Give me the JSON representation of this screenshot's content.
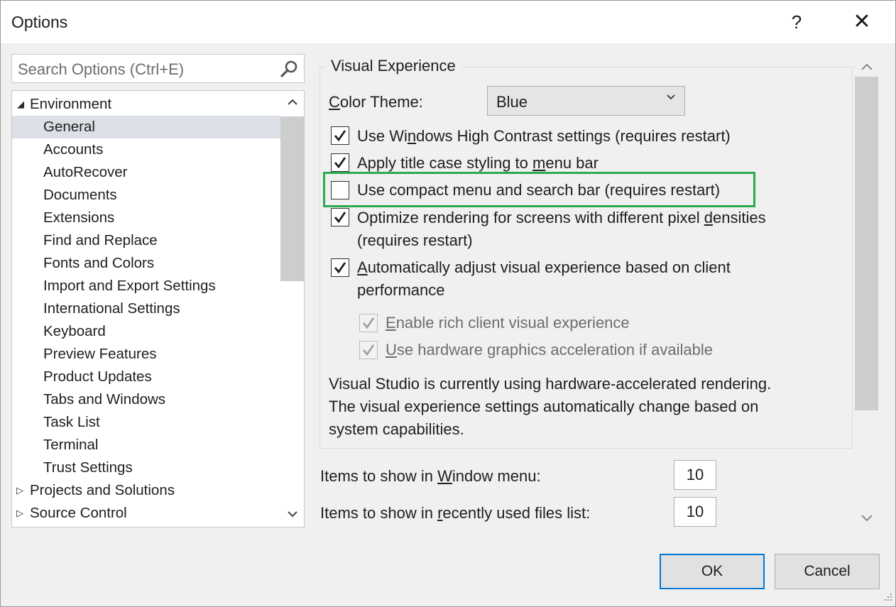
{
  "window": {
    "title": "Options",
    "help_glyph": "?",
    "close_glyph": "✕"
  },
  "search": {
    "placeholder": "Search Options (Ctrl+E)"
  },
  "tree": {
    "items": [
      {
        "label": "Environment",
        "level": 0,
        "expander": "expanded"
      },
      {
        "label": "General",
        "level": 1,
        "selected": true
      },
      {
        "label": "Accounts",
        "level": 1
      },
      {
        "label": "AutoRecover",
        "level": 1
      },
      {
        "label": "Documents",
        "level": 1
      },
      {
        "label": "Extensions",
        "level": 1
      },
      {
        "label": "Find and Replace",
        "level": 1
      },
      {
        "label": "Fonts and Colors",
        "level": 1
      },
      {
        "label": "Import and Export Settings",
        "level": 1
      },
      {
        "label": "International Settings",
        "level": 1
      },
      {
        "label": "Keyboard",
        "level": 1
      },
      {
        "label": "Preview Features",
        "level": 1
      },
      {
        "label": "Product Updates",
        "level": 1
      },
      {
        "label": "Tabs and Windows",
        "level": 1
      },
      {
        "label": "Task List",
        "level": 1
      },
      {
        "label": "Terminal",
        "level": 1
      },
      {
        "label": "Trust Settings",
        "level": 1
      },
      {
        "label": "Projects and Solutions",
        "level": 0,
        "expander": "collapsed"
      },
      {
        "label": "Source Control",
        "level": 0,
        "expander": "collapsed"
      }
    ]
  },
  "visual_experience": {
    "group_title": "Visual Experience",
    "color_theme": {
      "label_key": "C",
      "label_rest": "olor Theme:",
      "value": "Blue"
    },
    "options": {
      "high_contrast": {
        "pre": "Use Wi",
        "key": "n",
        "post": "dows High Contrast settings (requires restart)",
        "checked": true
      },
      "title_case": {
        "pre": "Apply title case styling to ",
        "key": "m",
        "post": "enu bar",
        "checked": true
      },
      "compact_menu": {
        "text": "Use compact menu and search bar (requires restart)",
        "checked": false,
        "highlighted": true
      },
      "optimize_rendering": {
        "pre": "Optimize rendering for screens with different pixel ",
        "key": "d",
        "post": "ensities",
        "line2": "(requires restart)",
        "checked": true
      },
      "auto_adjust": {
        "key": "A",
        "post": "utomatically adjust visual experience based on client",
        "line2": "performance",
        "checked": true
      },
      "rich_client": {
        "key": "E",
        "post": "nable rich client visual experience",
        "checked": true,
        "disabled": true
      },
      "hw_accel": {
        "key": "U",
        "post": "se hardware graphics acceleration if available",
        "checked": true,
        "disabled": true
      }
    },
    "info": {
      "line1": "Visual Studio is currently using hardware-accelerated rendering.",
      "line2": "The visual experience settings automatically change based on",
      "line3": "system capabilities."
    }
  },
  "window_menu": {
    "pre": "Items to show in ",
    "key": "W",
    "post": "indow menu:",
    "value": "10"
  },
  "recent_files": {
    "pre": "Items to show in ",
    "key": "r",
    "post": "ecently used files list:",
    "value": "10"
  },
  "buttons": {
    "ok": "OK",
    "cancel": "Cancel"
  }
}
